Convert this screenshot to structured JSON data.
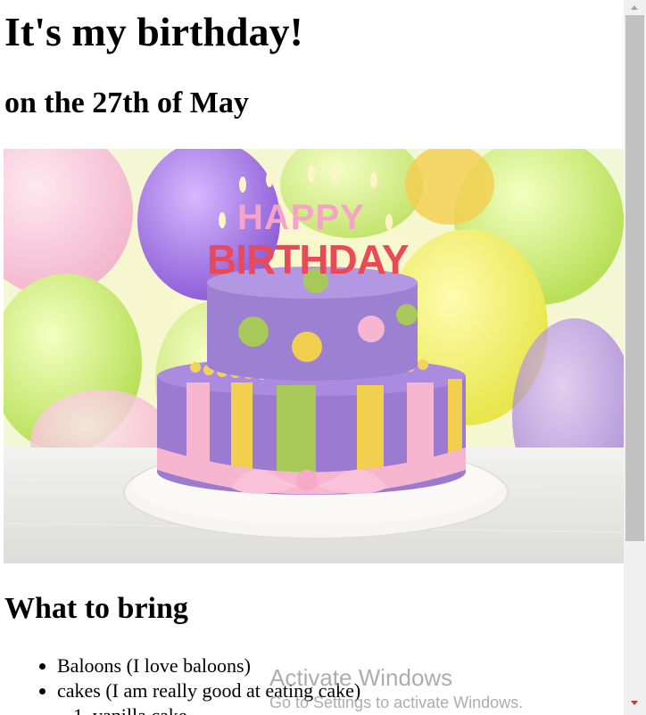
{
  "page": {
    "title": "It's my birthday!",
    "subtitle": "on the 27th of May",
    "section_heading": "What to bring",
    "items": [
      "Baloons (I love baloons)",
      "cakes (I am really good at eating cake)"
    ],
    "sub_items": [
      "vanilla cake"
    ]
  },
  "hero_image": {
    "alt": "birthday cake",
    "cake_text_top": "HAPPY",
    "cake_text_bottom": "BIRTHDAY"
  },
  "watermark": {
    "title": "Activate Windows",
    "subtitle": "Go to Settings to activate Windows."
  },
  "colors": {
    "cake_purple": "#9b7bd0",
    "cake_yellow": "#f3cf4f",
    "cake_green": "#a7c95a",
    "cake_pink": "#f7b6cf",
    "plate": "#f4f1ec"
  }
}
